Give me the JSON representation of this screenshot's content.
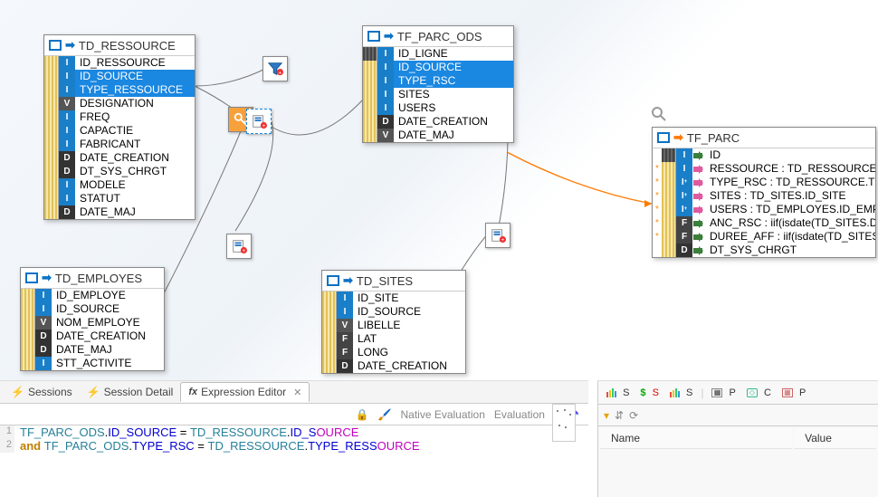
{
  "entities": {
    "td_ressource": {
      "title": "TD_RESSOURCE",
      "rows": [
        {
          "type": "I",
          "name": "ID_RESSOURCE"
        },
        {
          "type": "I",
          "name": "ID_SOURCE",
          "selected": true
        },
        {
          "type": "I",
          "name": "TYPE_RESSOURCE",
          "selected": true
        },
        {
          "type": "V",
          "name": "DESIGNATION"
        },
        {
          "type": "I",
          "name": "FREQ"
        },
        {
          "type": "I",
          "name": "CAPACTIE"
        },
        {
          "type": "I",
          "name": "FABRICANT"
        },
        {
          "type": "D",
          "name": "DATE_CREATION"
        },
        {
          "type": "D",
          "name": "DT_SYS_CHRGT"
        },
        {
          "type": "I",
          "name": "MODELE"
        },
        {
          "type": "I",
          "name": "STATUT"
        },
        {
          "type": "D",
          "name": "DATE_MAJ"
        }
      ]
    },
    "tf_parc_ods": {
      "title": "TF_PARC_ODS",
      "rows": [
        {
          "type": "I",
          "name": "ID_LIGNE",
          "dark": true
        },
        {
          "type": "I",
          "name": "ID_SOURCE",
          "selected": true
        },
        {
          "type": "I",
          "name": "TYPE_RSC",
          "selected": true
        },
        {
          "type": "I",
          "name": "SITES"
        },
        {
          "type": "I",
          "name": "USERS"
        },
        {
          "type": "D",
          "name": "DATE_CREATION"
        },
        {
          "type": "V",
          "name": "DATE_MAJ"
        }
      ]
    },
    "td_employes": {
      "title": "TD_EMPLOYES",
      "rows": [
        {
          "type": "I",
          "name": "ID_EMPLOYE"
        },
        {
          "type": "I",
          "name": "ID_SOURCE"
        },
        {
          "type": "V",
          "name": "NOM_EMPLOYE"
        },
        {
          "type": "D",
          "name": "DATE_CREATION"
        },
        {
          "type": "D",
          "name": "DATE_MAJ"
        },
        {
          "type": "I",
          "name": "STT_ACTIVITE"
        }
      ]
    },
    "td_sites": {
      "title": "TD_SITES",
      "rows": [
        {
          "type": "I",
          "name": "ID_SITE"
        },
        {
          "type": "I",
          "name": "ID_SOURCE"
        },
        {
          "type": "V",
          "name": "LIBELLE"
        },
        {
          "type": "F",
          "name": "LAT"
        },
        {
          "type": "F",
          "name": "LONG"
        },
        {
          "type": "D",
          "name": "DATE_CREATION"
        }
      ]
    },
    "tf_parc": {
      "title": "TF_PARC",
      "rows": [
        {
          "type": "I",
          "name": "ID",
          "dark": true,
          "port": "green"
        },
        {
          "type": "I",
          "name": "RESSOURCE : TD_RESSOURCE.ID_R",
          "port": "pink",
          "star": true
        },
        {
          "type": "I+",
          "name": "TYPE_RSC : TD_RESSOURCE.TYPE_",
          "port": "pink",
          "star": true
        },
        {
          "type": "I+",
          "name": "SITES : TD_SITES.ID_SITE",
          "port": "pink",
          "star": true
        },
        {
          "type": "I+",
          "name": "USERS : TD_EMPLOYES.ID_EMPLOY",
          "port": "pink",
          "star": true
        },
        {
          "type": "F",
          "name": "ANC_RSC : iif(isdate(TD_SITES.DAT",
          "port": "green",
          "star": true
        },
        {
          "type": "F",
          "name": "DUREE_AFF : iif(isdate(TD_SITES.DA",
          "port": "green",
          "star": true
        },
        {
          "type": "D",
          "name": "DT_SYS_CHRGT",
          "port": "green"
        }
      ]
    }
  },
  "tabs": {
    "sessions": "Sessions",
    "session_detail": "Session Detail",
    "expression_editor": "Expression Editor"
  },
  "toolbar": {
    "native_eval": "Native Evaluation",
    "eval": "Evaluation"
  },
  "expression": {
    "l1": {
      "obj1": "TF_PARC_ODS",
      "f1": "ID_SOURCE",
      "op": "=",
      "obj2": "TD_RESSOURCE",
      "f2": "ID_S",
      "f2suf": "OURCE"
    },
    "l2": {
      "kw": "and",
      "obj1": "TF_PARC_ODS",
      "f1": "TYPE_RSC",
      "op": "=",
      "obj2": "TD_RESSOURCE",
      "f2": "TYPE_RESS",
      "f2suf": "OURCE"
    }
  },
  "right_icons": {
    "s1": "S",
    "s2": "S",
    "s3": "S",
    "p1": "P",
    "c1": "C",
    "p2": "P"
  },
  "value_table": {
    "col_name": "Name",
    "col_value": "Value"
  }
}
